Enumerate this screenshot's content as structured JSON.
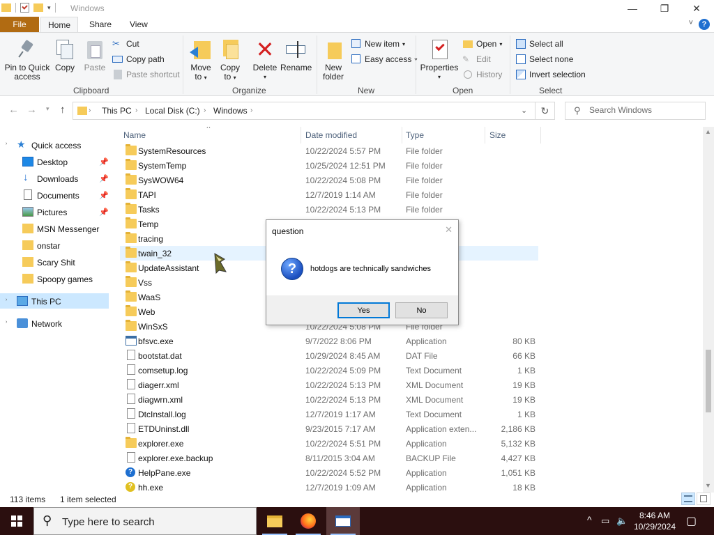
{
  "window": {
    "title": "Windows"
  },
  "tabs": {
    "file": "File",
    "home": "Home",
    "share": "Share",
    "view": "View"
  },
  "ribbon": {
    "clipboard": {
      "label": "Clipboard",
      "pin": "Pin to Quick access",
      "pin_l1": "Pin to Quick",
      "pin_l2": "access",
      "copy": "Copy",
      "paste": "Paste",
      "cut": "Cut",
      "copy_path": "Copy path",
      "paste_shortcut": "Paste shortcut"
    },
    "organize": {
      "label": "Organize",
      "move_l1": "Move",
      "move_l2": "to",
      "copy_l1": "Copy",
      "copy_l2": "to",
      "delete": "Delete",
      "rename": "Rename"
    },
    "new": {
      "label": "New",
      "new_folder_l1": "New",
      "new_folder_l2": "folder",
      "new_item": "New item",
      "easy_access": "Easy access"
    },
    "open": {
      "label": "Open",
      "properties": "Properties",
      "open": "Open",
      "edit": "Edit",
      "history": "History"
    },
    "select": {
      "label": "Select",
      "select_all": "Select all",
      "select_none": "Select none",
      "invert": "Invert selection"
    }
  },
  "address": {
    "crumbs": [
      "This PC",
      "Local Disk (C:)",
      "Windows"
    ],
    "search_placeholder": "Search Windows"
  },
  "nav": {
    "quick_access": "Quick access",
    "items": [
      {
        "label": "Desktop",
        "pinned": true
      },
      {
        "label": "Downloads",
        "pinned": true
      },
      {
        "label": "Documents",
        "pinned": true
      },
      {
        "label": "Pictures",
        "pinned": true
      },
      {
        "label": "MSN Messenger"
      },
      {
        "label": "onstar"
      },
      {
        "label": "Scary Shit"
      },
      {
        "label": "Spoopy games"
      }
    ],
    "this_pc": "This PC",
    "network": "Network"
  },
  "columns": {
    "name": "Name",
    "date": "Date modified",
    "type": "Type",
    "size": "Size"
  },
  "files": [
    {
      "name": "SystemResources",
      "date": "10/22/2024 5:57 PM",
      "type": "File folder",
      "size": "",
      "icon": "folder"
    },
    {
      "name": "SystemTemp",
      "date": "10/25/2024 12:51 PM",
      "type": "File folder",
      "size": "",
      "icon": "folder"
    },
    {
      "name": "SysWOW64",
      "date": "10/22/2024 5:08 PM",
      "type": "File folder",
      "size": "",
      "icon": "folder"
    },
    {
      "name": "TAPI",
      "date": "12/7/2019 1:14 AM",
      "type": "File folder",
      "size": "",
      "icon": "folder"
    },
    {
      "name": "Tasks",
      "date": "10/22/2024 5:13 PM",
      "type": "File folder",
      "size": "",
      "icon": "folder"
    },
    {
      "name": "Temp",
      "date": "",
      "type": "",
      "size": "",
      "icon": "folder"
    },
    {
      "name": "tracing",
      "date": "",
      "type": "",
      "size": "",
      "icon": "folder"
    },
    {
      "name": "twain_32",
      "date": "",
      "type": "",
      "size": "",
      "icon": "folder",
      "selected": true
    },
    {
      "name": "UpdateAssistant",
      "date": "",
      "type": "",
      "size": "",
      "icon": "folder"
    },
    {
      "name": "Vss",
      "date": "",
      "type": "",
      "size": "",
      "icon": "folder"
    },
    {
      "name": "WaaS",
      "date": "",
      "type": "",
      "size": "",
      "icon": "folder"
    },
    {
      "name": "Web",
      "date": "",
      "type": "",
      "size": "",
      "icon": "folder"
    },
    {
      "name": "WinSxS",
      "date": "10/22/2024 5:08 PM",
      "type": "File folder",
      "size": "",
      "icon": "folder"
    },
    {
      "name": "bfsvc.exe",
      "date": "9/7/2022 8:06 PM",
      "type": "Application",
      "size": "80 KB",
      "icon": "exe"
    },
    {
      "name": "bootstat.dat",
      "date": "10/29/2024 8:45 AM",
      "type": "DAT File",
      "size": "66 KB",
      "icon": "file"
    },
    {
      "name": "comsetup.log",
      "date": "10/22/2024 5:09 PM",
      "type": "Text Document",
      "size": "1 KB",
      "icon": "file"
    },
    {
      "name": "diagerr.xml",
      "date": "10/22/2024 5:13 PM",
      "type": "XML Document",
      "size": "19 KB",
      "icon": "file"
    },
    {
      "name": "diagwrn.xml",
      "date": "10/22/2024 5:13 PM",
      "type": "XML Document",
      "size": "19 KB",
      "icon": "file"
    },
    {
      "name": "DtcInstall.log",
      "date": "12/7/2019 1:17 AM",
      "type": "Text Document",
      "size": "1 KB",
      "icon": "file"
    },
    {
      "name": "ETDUninst.dll",
      "date": "9/23/2015 7:17 AM",
      "type": "Application exten...",
      "size": "2,186 KB",
      "icon": "file"
    },
    {
      "name": "explorer.exe",
      "date": "10/22/2024 5:51 PM",
      "type": "Application",
      "size": "5,132 KB",
      "icon": "folder"
    },
    {
      "name": "explorer.exe.backup",
      "date": "8/11/2015 3:04 AM",
      "type": "BACKUP File",
      "size": "4,427 KB",
      "icon": "file"
    },
    {
      "name": "HelpPane.exe",
      "date": "10/22/2024 5:52 PM",
      "type": "Application",
      "size": "1,051 KB",
      "icon": "help"
    },
    {
      "name": "hh.exe",
      "date": "12/7/2019 1:09 AM",
      "type": "Application",
      "size": "18 KB",
      "icon": "help2"
    }
  ],
  "status": {
    "items": "113 items",
    "selected": "1 item selected"
  },
  "dialog": {
    "title": "question",
    "close": "✕",
    "icon_glyph": "?",
    "message": "hotdogs are technically sandwiches",
    "yes": "Yes",
    "no": "No"
  },
  "taskbar": {
    "search_placeholder": "Type here to search",
    "time": "8:46 AM",
    "date": "10/29/2024"
  },
  "colors": {
    "file_tab": "#b16b12",
    "selection": "#cce8ff",
    "accent": "#0078d7",
    "taskbar": "#2b0f0f"
  }
}
